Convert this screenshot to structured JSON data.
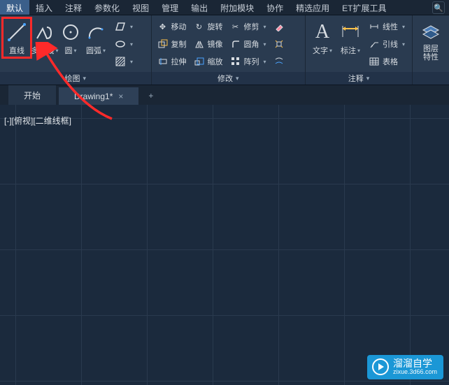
{
  "menu": {
    "items": [
      "默认",
      "插入",
      "注释",
      "参数化",
      "视图",
      "管理",
      "输出",
      "附加模块",
      "协作",
      "精选应用",
      "ET扩展工具"
    ],
    "active_index": 0,
    "search_icon": "🔍"
  },
  "ribbon": {
    "draw": {
      "title": "绘图",
      "line": "直线",
      "polyline": "多段线",
      "circle": "圆",
      "arc": "圆弧"
    },
    "modify": {
      "title": "修改",
      "move": "移动",
      "copy": "复制",
      "stretch": "拉伸",
      "rotate": "旋转",
      "mirror": "镜像",
      "scale": "缩放",
      "trim": "修剪",
      "fillet": "圆角",
      "array": "阵列"
    },
    "annot": {
      "title": "注释",
      "text": "文字",
      "dim": "标注",
      "linetype": "线性",
      "leader": "引线",
      "table": "表格"
    },
    "layer": {
      "label": "图层\n特性"
    }
  },
  "tabs": {
    "start": "开始",
    "drawing": "Drawing1*"
  },
  "viewport": {
    "label": "[-][俯视][二维线框]"
  },
  "watermark": {
    "name": "溜溜自学",
    "url": "zixue.3d66.com"
  }
}
